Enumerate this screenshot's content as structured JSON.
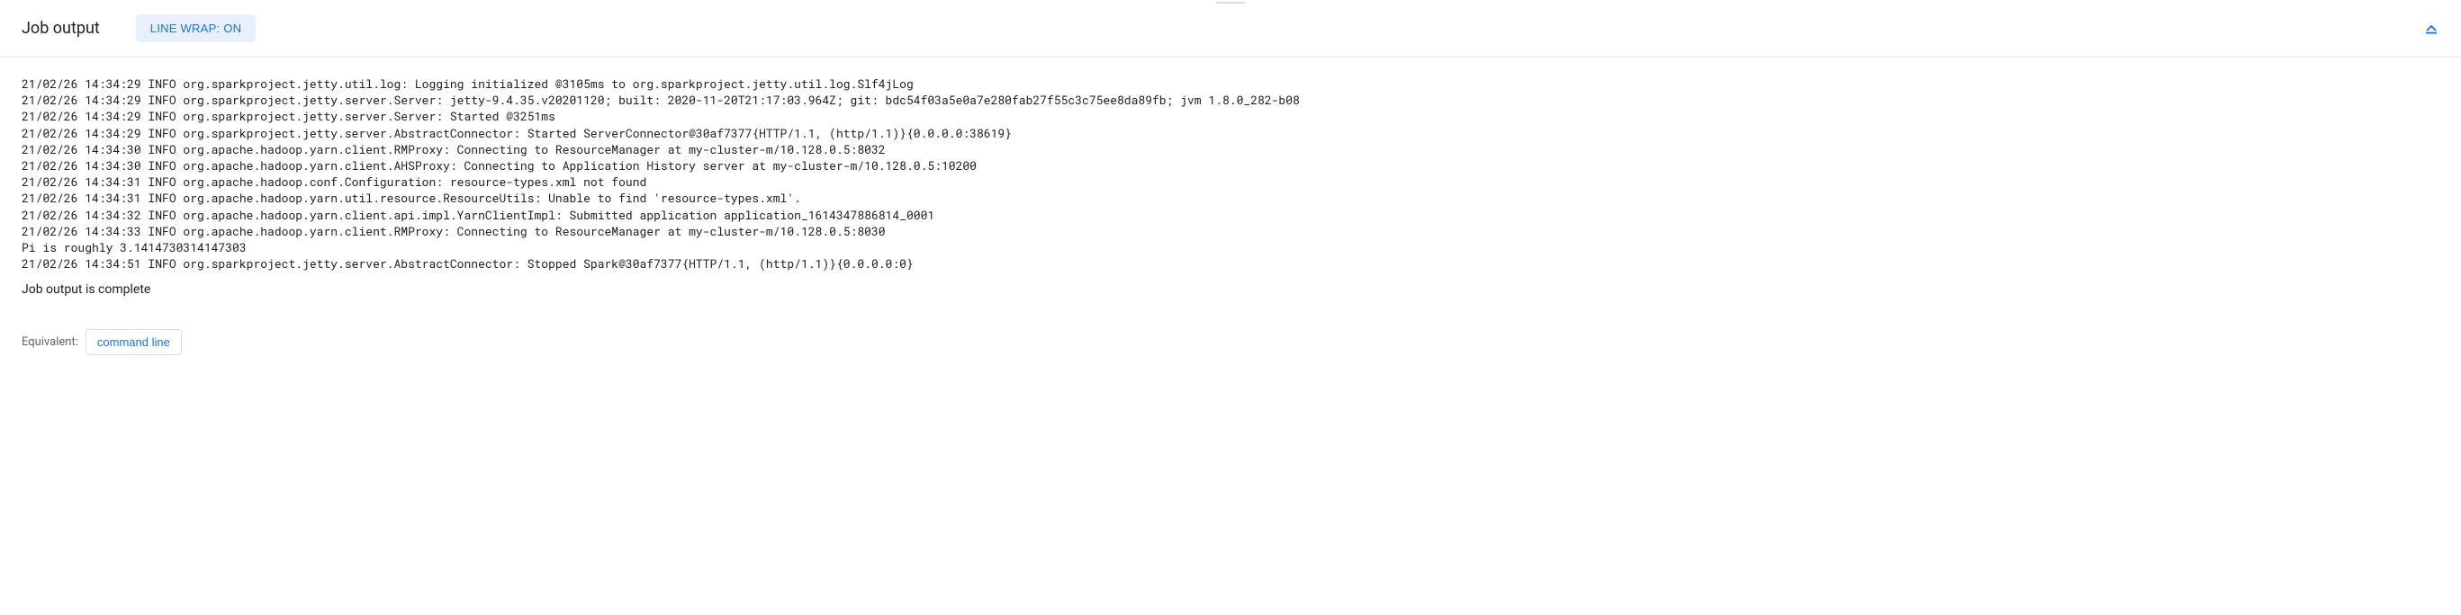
{
  "header": {
    "title": "Job output",
    "line_wrap_label": "LINE WRAP: ON"
  },
  "log": {
    "lines": [
      "21/02/26 14:34:29 INFO org.sparkproject.jetty.util.log: Logging initialized @3105ms to org.sparkproject.jetty.util.log.Slf4jLog",
      "21/02/26 14:34:29 INFO org.sparkproject.jetty.server.Server: jetty-9.4.35.v20201120; built: 2020-11-20T21:17:03.964Z; git: bdc54f03a5e0a7e280fab27f55c3c75ee8da89fb; jvm 1.8.0_282-b08",
      "21/02/26 14:34:29 INFO org.sparkproject.jetty.server.Server: Started @3251ms",
      "21/02/26 14:34:29 INFO org.sparkproject.jetty.server.AbstractConnector: Started ServerConnector@30af7377{HTTP/1.1, (http/1.1)}{0.0.0.0:38619}",
      "21/02/26 14:34:30 INFO org.apache.hadoop.yarn.client.RMProxy: Connecting to ResourceManager at my-cluster-m/10.128.0.5:8032",
      "21/02/26 14:34:30 INFO org.apache.hadoop.yarn.client.AHSProxy: Connecting to Application History server at my-cluster-m/10.128.0.5:10200",
      "21/02/26 14:34:31 INFO org.apache.hadoop.conf.Configuration: resource-types.xml not found",
      "21/02/26 14:34:31 INFO org.apache.hadoop.yarn.util.resource.ResourceUtils: Unable to find 'resource-types.xml'.",
      "21/02/26 14:34:32 INFO org.apache.hadoop.yarn.client.api.impl.YarnClientImpl: Submitted application application_1614347886814_0001",
      "21/02/26 14:34:33 INFO org.apache.hadoop.yarn.client.RMProxy: Connecting to ResourceManager at my-cluster-m/10.128.0.5:8030",
      "Pi is roughly 3.1414730314147303",
      "21/02/26 14:34:51 INFO org.sparkproject.jetty.server.AbstractConnector: Stopped Spark@30af7377{HTTP/1.1, (http/1.1)}{0.0.0.0:0}"
    ]
  },
  "completion": {
    "message": "Job output is complete"
  },
  "equivalent": {
    "label": "Equivalent:",
    "button": "command line"
  }
}
